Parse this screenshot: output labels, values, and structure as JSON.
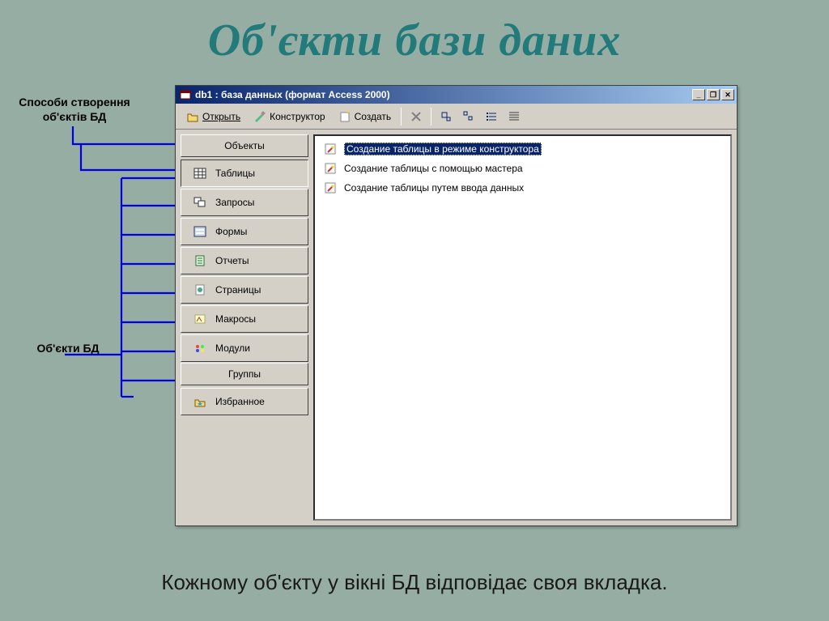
{
  "slide": {
    "title": "Об'єкти бази даних",
    "footer": "Кожному об'єкту у вікні БД відповідає своя вкладка."
  },
  "callouts": {
    "creation_methods": "Способи створення об'єктів БД",
    "db_objects": "Об'єкти БД"
  },
  "window": {
    "title": "db1 : база данных (формат Access 2000)",
    "controls": {
      "minimize": "_",
      "maximize": "❐",
      "close": "✕"
    }
  },
  "toolbar": {
    "open": "Открыть",
    "design": "Конструктор",
    "create": "Создать"
  },
  "sidebar": {
    "objects_header": "Объекты",
    "groups_header": "Группы",
    "items": [
      {
        "label": "Таблицы"
      },
      {
        "label": "Запросы"
      },
      {
        "label": "Формы"
      },
      {
        "label": "Отчеты"
      },
      {
        "label": "Страницы"
      },
      {
        "label": "Макросы"
      },
      {
        "label": "Модули"
      }
    ],
    "favorites": "Избранное"
  },
  "content": {
    "items": [
      {
        "label": "Создание таблицы в режиме конструктора"
      },
      {
        "label": "Создание таблицы с помощью мастера"
      },
      {
        "label": "Создание таблицы путем ввода данных"
      }
    ]
  }
}
